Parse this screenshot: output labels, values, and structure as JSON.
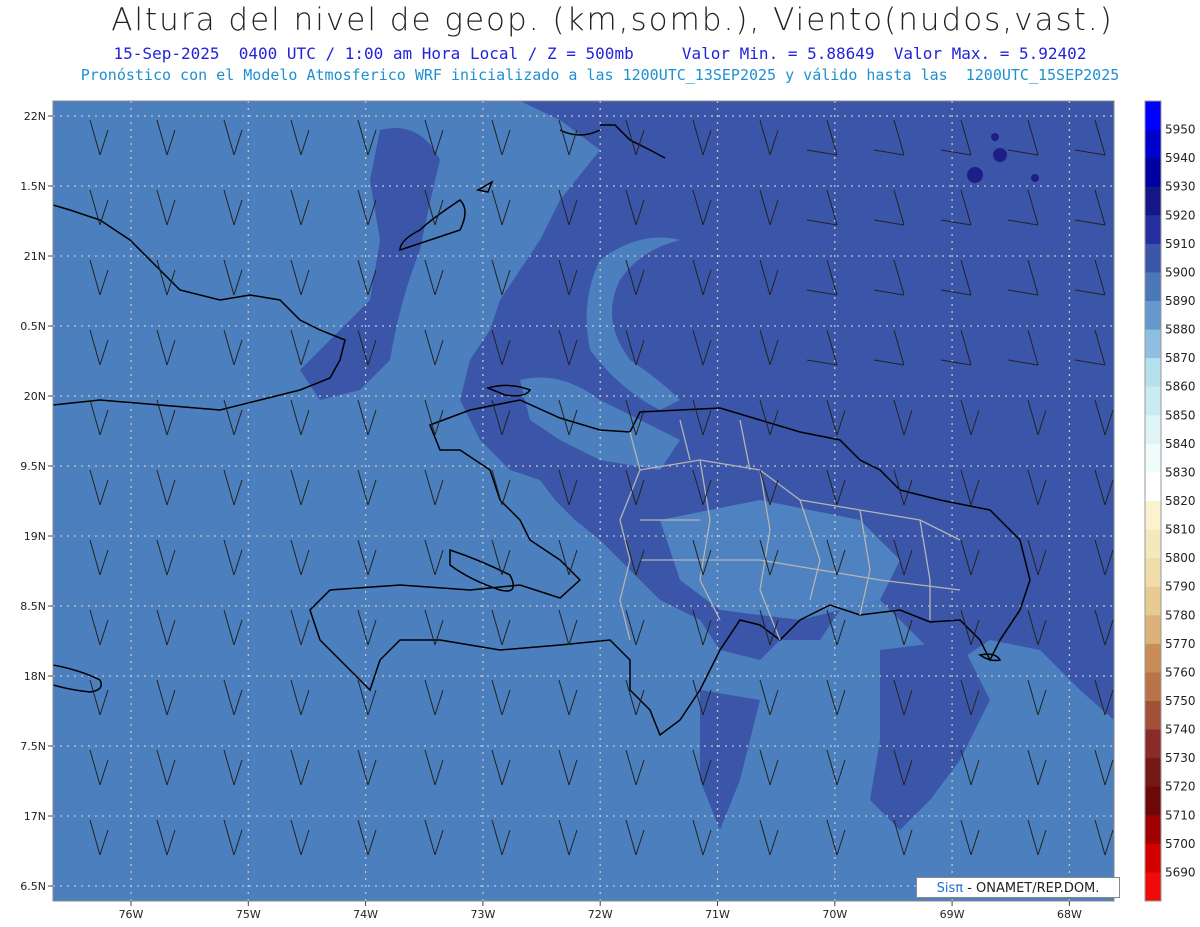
{
  "header": {
    "title": "Altura del nivel de geop. (km,somb.), Viento(nudos,vast.)",
    "subtitle1": "15-Sep-2025  0400 UTC / 1:00 am Hora Local / Z = 500mb     Valor Min. = 5.88649  Valor Max. = 5.92402",
    "subtitle2": "Pronóstico con el Modelo Atmosferico WRF inicializado a las 1200UTC_13SEP2025 y válido hasta las  1200UTC_15SEP2025"
  },
  "axes": {
    "lat_labels": [
      "22N",
      "1.5N",
      "21N",
      "0.5N",
      "20N",
      "9.5N",
      "19N",
      "8.5N",
      "18N",
      "7.5N",
      "17N",
      "6.5N"
    ],
    "lon_labels": [
      "76W",
      "75W",
      "74W",
      "73W",
      "72W",
      "71W",
      "70W",
      "69W",
      "68W"
    ]
  },
  "colorbar": {
    "labels": [
      "5950",
      "5940",
      "5930",
      "5920",
      "5910",
      "5900",
      "5890",
      "5880",
      "5870",
      "5860",
      "5850",
      "5840",
      "5830",
      "5820",
      "5810",
      "5800",
      "5790",
      "5780",
      "5770",
      "5760",
      "5750",
      "5740",
      "5730",
      "5720",
      "5710",
      "5700",
      "5690"
    ],
    "colors": [
      "#0000ff",
      "#0000cc",
      "#0000a0",
      "#161688",
      "#262fa0",
      "#3b56a8",
      "#4b78b8",
      "#6598cc",
      "#8fbfe0",
      "#b5e0ee",
      "#c8ecf2",
      "#dff4f8",
      "#f0fbfc",
      "#ffffff",
      "#fbf3d0",
      "#f6e8bd",
      "#f0dcaa",
      "#e8cb92",
      "#dab27a",
      "#c98e58",
      "#b87448",
      "#a35038",
      "#8a2a2a",
      "#741818",
      "#6e0808",
      "#a00000",
      "#d40000",
      "#f00a0a"
    ]
  },
  "credit": {
    "brand": "Sisπ",
    "text": " - ONAMET/REP.DOM."
  },
  "colors": {
    "sea_level": "#4c7fbd",
    "high_level": "#3a57a6",
    "land_outline": "#000000",
    "province_lines": "#b4b4b4",
    "grid": "#c8c8c8"
  }
}
